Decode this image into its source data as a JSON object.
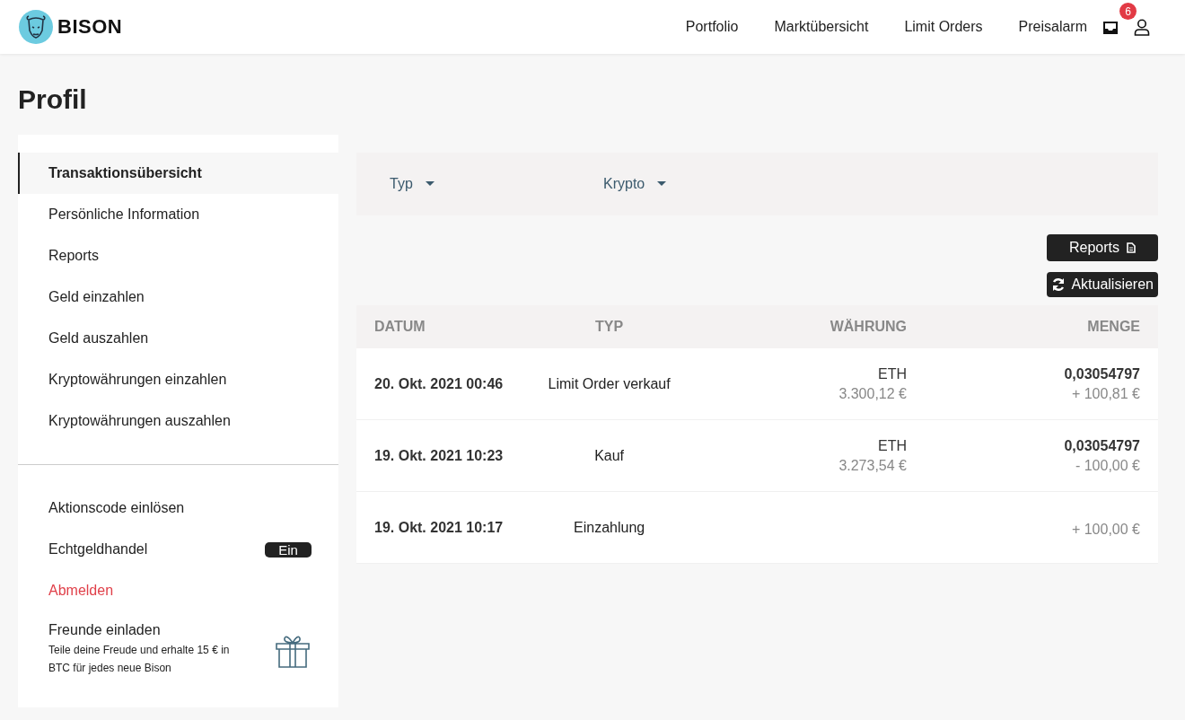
{
  "header": {
    "brand": "BISON",
    "nav": [
      "Portfolio",
      "Marktübersicht",
      "Limit Orders",
      "Preisalarm"
    ],
    "inbox_badge": "6"
  },
  "page_title": "Profil",
  "sidebar": {
    "items": [
      {
        "label": "Transaktionsübersicht",
        "selected": true
      },
      {
        "label": "Persönliche Information",
        "selected": false
      },
      {
        "label": "Reports",
        "selected": false
      },
      {
        "label": "Geld einzahlen",
        "selected": false
      },
      {
        "label": "Geld auszahlen",
        "selected": false
      },
      {
        "label": "Kryptowährungen einzahlen",
        "selected": false
      },
      {
        "label": "Kryptowährungen auszahlen",
        "selected": false
      }
    ],
    "promo_code": "Aktionscode einlösen",
    "real_money": {
      "label": "Echtgeldhandel",
      "toggle": "Ein",
      "on": true
    },
    "logout": "Abmelden",
    "invite": {
      "title": "Freunde einladen",
      "text": "Teile deine Freude und erhalte 15 € in BTC für jedes neue Bison"
    }
  },
  "filters": [
    "Typ",
    "Krypto"
  ],
  "buttons": {
    "reports": "Reports",
    "refresh": "Aktualisieren"
  },
  "table": {
    "columns": [
      "DATUM",
      "TYP",
      "WÄHRUNG",
      "MENGE"
    ],
    "rows": [
      {
        "date": "20. Okt. 2021 00:46",
        "type": "Limit Order verkauf",
        "currency": "ETH",
        "price": "3.300,12 €",
        "amount": "0,03054797",
        "value": "+ 100,81 €"
      },
      {
        "date": "19. Okt. 2021 10:23",
        "type": "Kauf",
        "currency": "ETH",
        "price": "3.273,54 €",
        "amount": "0,03054797",
        "value": "- 100,00 €"
      },
      {
        "date": "19. Okt. 2021 10:17",
        "type": "Einzahlung",
        "value": "+ 100,00 €"
      }
    ]
  }
}
